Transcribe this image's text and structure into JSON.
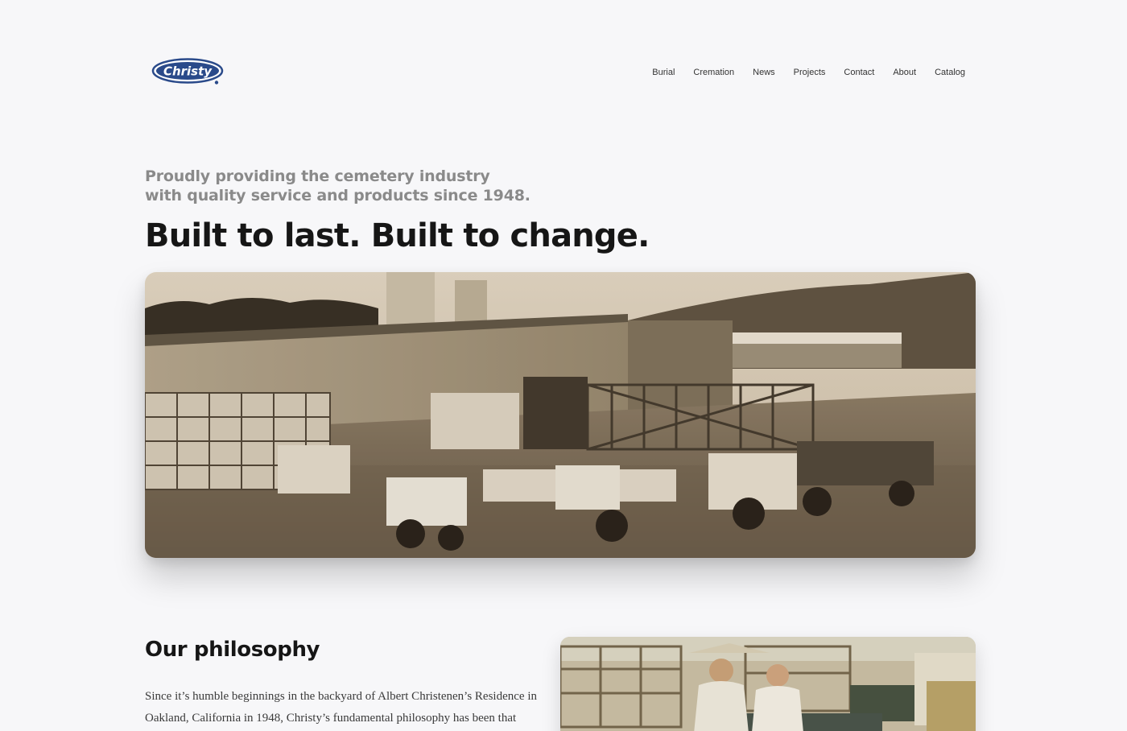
{
  "header": {
    "logo_text": "Christy",
    "nav": [
      {
        "label": "Burial"
      },
      {
        "label": "Cremation"
      },
      {
        "label": "News"
      },
      {
        "label": "Projects"
      },
      {
        "label": "Contact"
      },
      {
        "label": "About"
      },
      {
        "label": "Catalog"
      }
    ]
  },
  "hero": {
    "tagline": "Proudly providing the cemetery industry with quality service and products since 1948.",
    "headline": "Built to last. Built to change."
  },
  "philosophy": {
    "title": "Our philosophy",
    "text": "Since it’s humble beginnings in the backyard of Albert Christenen’s Residence in Oakland, California in 1948, Christy’s fundamental philosophy has been that"
  },
  "colors": {
    "background": "#f7f7f9",
    "logo_blue": "#2a4a8a",
    "headline": "#161616",
    "tagline": "#8a8a8a"
  }
}
